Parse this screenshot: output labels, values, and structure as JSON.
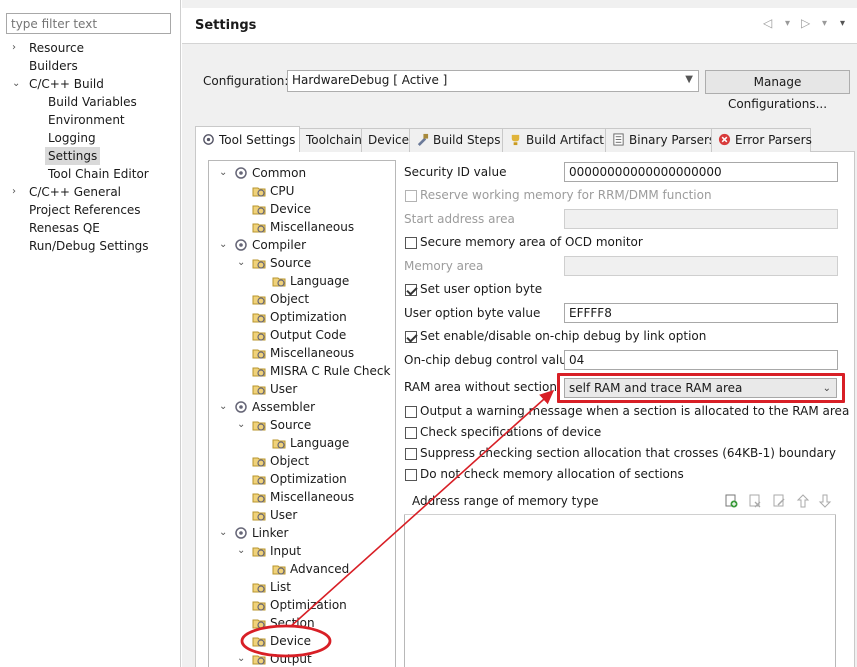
{
  "nav": {
    "filter_placeholder": "type filter text",
    "items": [
      {
        "label": "Resource",
        "chevron": "›"
      },
      {
        "label": "Builders",
        "chevron": ""
      },
      {
        "label": "C/C++ Build",
        "chevron": "⌄"
      },
      {
        "label": "Build Variables",
        "chevron": ""
      },
      {
        "label": "Environment",
        "chevron": ""
      },
      {
        "label": "Logging",
        "chevron": ""
      },
      {
        "label": "Settings",
        "chevron": ""
      },
      {
        "label": "Tool Chain Editor",
        "chevron": ""
      },
      {
        "label": "C/C++ General",
        "chevron": "›"
      },
      {
        "label": "Project References",
        "chevron": ""
      },
      {
        "label": "Renesas QE",
        "chevron": ""
      },
      {
        "label": "Run/Debug Settings",
        "chevron": ""
      }
    ]
  },
  "header": {
    "title": "Settings",
    "back_icon": "◁",
    "forward_icon": "▷",
    "dropdown_icon": "▾"
  },
  "config": {
    "label": "Configuration:",
    "value": "HardwareDebug  [ Active ]",
    "manage_label": "Manage Configurations..."
  },
  "tabs": [
    {
      "label": "Tool Settings",
      "icon": "tool-settings-icon"
    },
    {
      "label": "Toolchain",
      "icon": ""
    },
    {
      "label": "Device",
      "icon": ""
    },
    {
      "label": "Build Steps",
      "icon": "build-steps-icon"
    },
    {
      "label": "Build Artifact",
      "icon": "build-artifact-icon"
    },
    {
      "label": "Binary Parsers",
      "icon": "binary-parsers-icon"
    },
    {
      "label": "Error Parsers",
      "icon": "error-parsers-icon"
    }
  ],
  "tree": [
    {
      "label": "Common"
    },
    {
      "label": "CPU"
    },
    {
      "label": "Device"
    },
    {
      "label": "Miscellaneous"
    },
    {
      "label": "Compiler"
    },
    {
      "label": "Source"
    },
    {
      "label": "Language"
    },
    {
      "label": "Object"
    },
    {
      "label": "Optimization"
    },
    {
      "label": "Output Code"
    },
    {
      "label": "Miscellaneous"
    },
    {
      "label": "MISRA C Rule Check"
    },
    {
      "label": "User"
    },
    {
      "label": "Assembler"
    },
    {
      "label": "Source"
    },
    {
      "label": "Language"
    },
    {
      "label": "Object"
    },
    {
      "label": "Optimization"
    },
    {
      "label": "Miscellaneous"
    },
    {
      "label": "User"
    },
    {
      "label": "Linker"
    },
    {
      "label": "Input"
    },
    {
      "label": "Advanced"
    },
    {
      "label": "List"
    },
    {
      "label": "Optimization"
    },
    {
      "label": "Section"
    },
    {
      "label": "Device"
    },
    {
      "label": "Output"
    }
  ],
  "form": {
    "security_id_label": "Security ID value",
    "security_id_value": "00000000000000000000",
    "reserve_label": "Reserve working memory for RRM/DMM function",
    "start_addr_label": "Start address area",
    "secure_ocd_label": "Secure memory area of OCD monitor",
    "memory_area_label": "Memory area",
    "set_user_option_label": "Set user option byte",
    "user_option_value_label": "User option byte value",
    "user_option_value": "EFFFF8",
    "onchip_debug_label": "Set enable/disable on-chip debug by link option",
    "onchip_ctrl_label": "On-chip debug control value",
    "onchip_ctrl_value": "04",
    "ram_area_label": "RAM area without section",
    "ram_area_value": "self RAM and trace RAM area",
    "warn_label": "Output a warning message when a section is allocated to the RAM area",
    "check_spec_label": "Check specifications of device",
    "suppress_label": "Suppress checking section allocation that crosses (64KB-1) boundary",
    "no_check_label": "Do not check memory allocation of sections",
    "addr_table_title": "Address range of memory type"
  },
  "colors": {
    "highlight": "#d81f26",
    "selection": "#d9d9d9"
  }
}
